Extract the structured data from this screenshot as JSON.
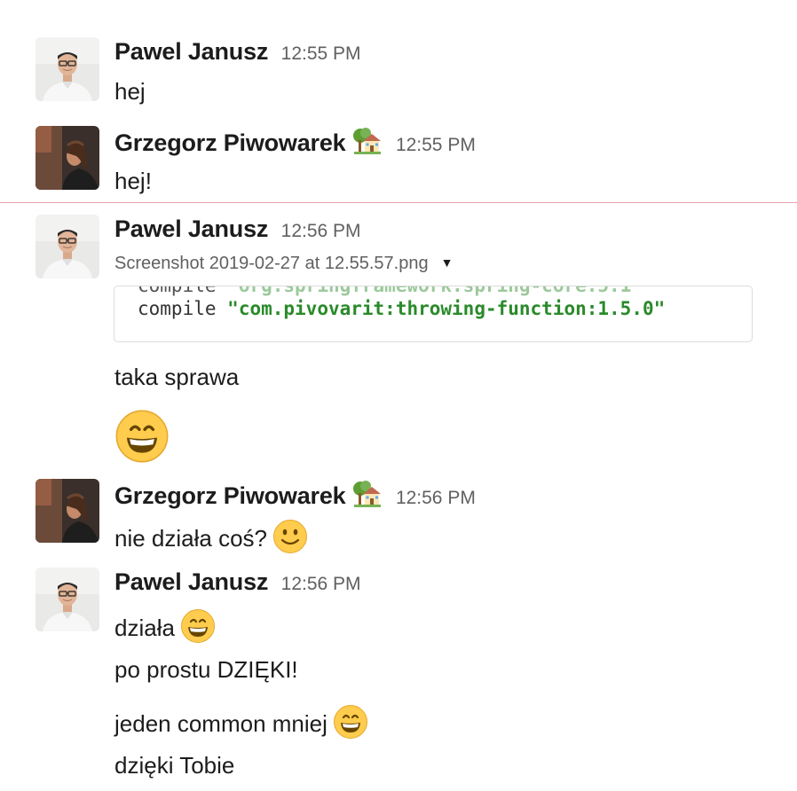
{
  "messages": [
    {
      "author": "Pawel Janusz",
      "time": "12:55 PM",
      "text": "hej"
    },
    {
      "author": "Grzegorz Piwowarek",
      "time": "12:55 PM",
      "text": "hej!"
    },
    {
      "author": "Pawel Janusz",
      "time": "12:56 PM",
      "attachment": {
        "filename": "Screenshot 2019-02-27 at 12.55.57.png",
        "code_keyword": "compile",
        "code_string": "\"com.pivovarit:throwing-function:1.5.0\""
      },
      "text": "taka sprawa"
    },
    {
      "author": "Grzegorz Piwowarek",
      "time": "12:56 PM",
      "text": "nie działa coś?"
    },
    {
      "author": "Pawel Janusz",
      "time": "12:56 PM",
      "lines": [
        "działa",
        "po prostu DZIĘKI!",
        "jeden common mniej",
        "dzięki Tobie"
      ]
    }
  ],
  "icons": {
    "status": "house-with-garden-icon",
    "smile": "slightly-smiling-face-icon",
    "grin": "grinning-face-icon"
  }
}
